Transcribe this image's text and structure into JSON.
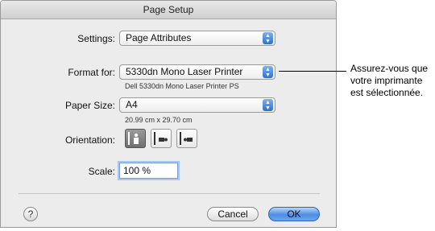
{
  "dialog": {
    "title": "Page Setup",
    "settings": {
      "label": "Settings:",
      "value": "Page Attributes"
    },
    "format_for": {
      "label": "Format for:",
      "value": "5330dn Mono Laser Printer",
      "subtext": "Dell 5330dn Mono Laser Printer PS"
    },
    "paper_size": {
      "label": "Paper Size:",
      "value": "A4",
      "subtext": "20.99 cm x 29.70 cm"
    },
    "orientation": {
      "label": "Orientation:",
      "options": [
        "portrait",
        "landscape-left",
        "landscape-right"
      ],
      "selected": "portrait"
    },
    "scale": {
      "label": "Scale:",
      "value": "100 %"
    },
    "help_label": "?",
    "cancel_label": "Cancel",
    "ok_label": "OK"
  },
  "callout": {
    "text": "Assurez-vous que votre imprimante est sélectionnée."
  },
  "colors": {
    "accent": "#4f8de0",
    "dialog_bg": "#ececec"
  }
}
